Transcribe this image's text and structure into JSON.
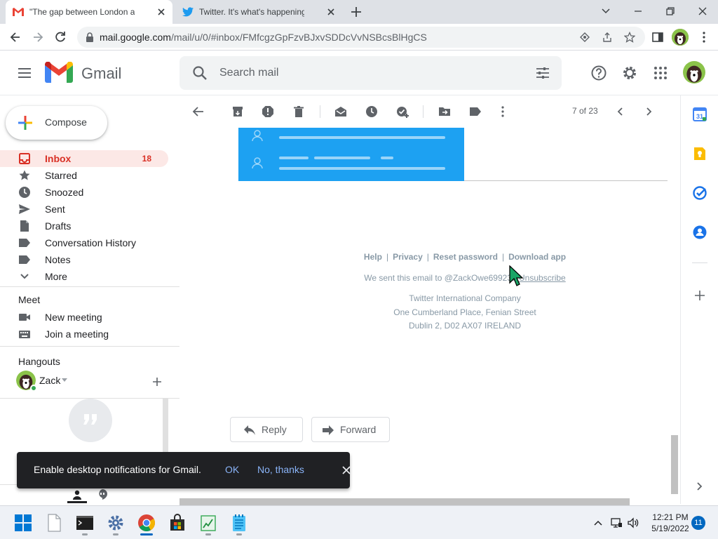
{
  "browser": {
    "tabs": [
      {
        "title": "\"The gap between London and the",
        "favicon": "gmail-icon",
        "active": true
      },
      {
        "title": "Twitter. It's what's happening / T",
        "favicon": "twitter-icon",
        "active": false
      }
    ],
    "url_host": "mail.google.com",
    "url_path": "/mail/u/0/#inbox/FMfcgzGpFzvBJxvSDDcVvNSBcsBlHgCS"
  },
  "gmail": {
    "brand": "Gmail",
    "search_placeholder": "Search mail",
    "compose_label": "Compose",
    "nav": [
      {
        "label": "Inbox",
        "count": "18",
        "icon": "inbox-icon"
      },
      {
        "label": "Starred",
        "count": "",
        "icon": "star-icon"
      },
      {
        "label": "Snoozed",
        "count": "",
        "icon": "clock-icon"
      },
      {
        "label": "Sent",
        "count": "",
        "icon": "send-icon"
      },
      {
        "label": "Drafts",
        "count": "",
        "icon": "draft-icon"
      },
      {
        "label": "Conversation History",
        "count": "",
        "icon": "label-icon"
      },
      {
        "label": "Notes",
        "count": "",
        "icon": "label-icon"
      },
      {
        "label": "More",
        "count": "",
        "icon": "chevron-down-icon"
      }
    ],
    "meet": {
      "title": "Meet",
      "items": [
        {
          "label": "New meeting",
          "icon": "video-icon"
        },
        {
          "label": "Join a meeting",
          "icon": "keyboard-icon"
        }
      ]
    },
    "hangouts": {
      "title": "Hangouts",
      "user": "Zack"
    },
    "toolbar": {
      "pager": "7 of 23"
    },
    "email": {
      "footer_links": [
        "Help",
        "Privacy",
        "Reset password",
        "Download app"
      ],
      "sent_to_prefix": "We sent this email to @ZackOwe699232",
      "unsubscribe": "Unsubscribe",
      "address": [
        "Twitter International Company",
        "One Cumberland Place, Fenian Street",
        "Dublin 2, D02 AX07  IRELAND"
      ]
    },
    "reply_label": "Reply",
    "forward_label": "Forward"
  },
  "toast": {
    "message": "Enable desktop notifications for Gmail.",
    "ok": "OK",
    "no_thanks": "No, thanks"
  },
  "taskbar": {
    "time": "12:21 PM",
    "date": "5/19/2022",
    "notification_count": "11"
  },
  "colors": {
    "gmail_red": "#d93025",
    "twitter_blue": "#1da1f2",
    "toast_link": "#8ab4f8"
  }
}
